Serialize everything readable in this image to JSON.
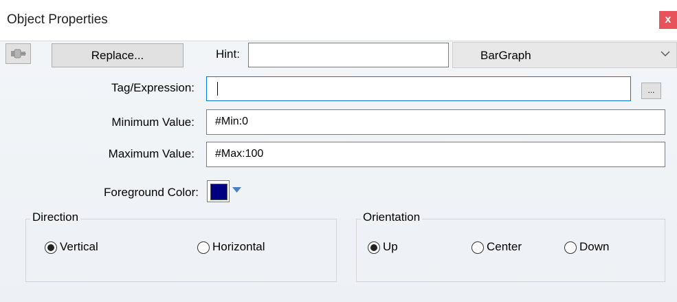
{
  "window": {
    "title": "Object Properties",
    "close_label": "x"
  },
  "toolbar": {
    "pin_icon": "pushpin-icon",
    "replace_label": "Replace...",
    "hint_label": "Hint:",
    "hint_value": "",
    "object_type": "BarGraph"
  },
  "fields": {
    "tag_label": "Tag/Expression:",
    "tag_value": "",
    "browse_label": "...",
    "min_label": "Minimum Value:",
    "min_value": "#Min:0",
    "max_label": "Maximum Value:",
    "max_value": "#Max:100",
    "fg_label": "Foreground Color:",
    "fg_color": "#000080"
  },
  "direction": {
    "title": "Direction",
    "options": [
      {
        "label": "Vertical",
        "checked": true
      },
      {
        "label": "Horizontal",
        "checked": false
      }
    ]
  },
  "orientation": {
    "title": "Orientation",
    "options": [
      {
        "label": "Up",
        "checked": true
      },
      {
        "label": "Center",
        "checked": false
      },
      {
        "label": "Down",
        "checked": false
      }
    ]
  }
}
